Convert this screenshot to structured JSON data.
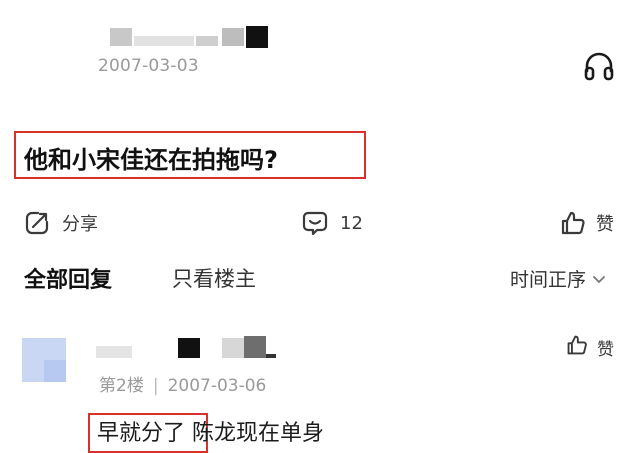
{
  "post": {
    "date": "2007-03-03",
    "title": "他和小宋佳还在拍拖吗?",
    "share_label": "分享",
    "comment_count": "12",
    "like_label": "赞"
  },
  "replies_header": {
    "tab_all": "全部回复",
    "tab_op_only": "只看楼主",
    "sort_label": "时间正序"
  },
  "reply": {
    "floor": "第2楼",
    "separator": "|",
    "date": "2007-03-06",
    "like_label": "赞",
    "text": "早就分了 陈龙现在单身"
  },
  "colors": {
    "highlight_border": "#d9302c",
    "meta_gray": "#9a9a9a",
    "avatar_blue": "#c9d7f5"
  },
  "icons": {
    "headphone": "headphone-icon",
    "share": "share-icon",
    "comment": "comment-icon",
    "like": "thumbs-up-icon",
    "sort": "chevron-down-icon"
  }
}
